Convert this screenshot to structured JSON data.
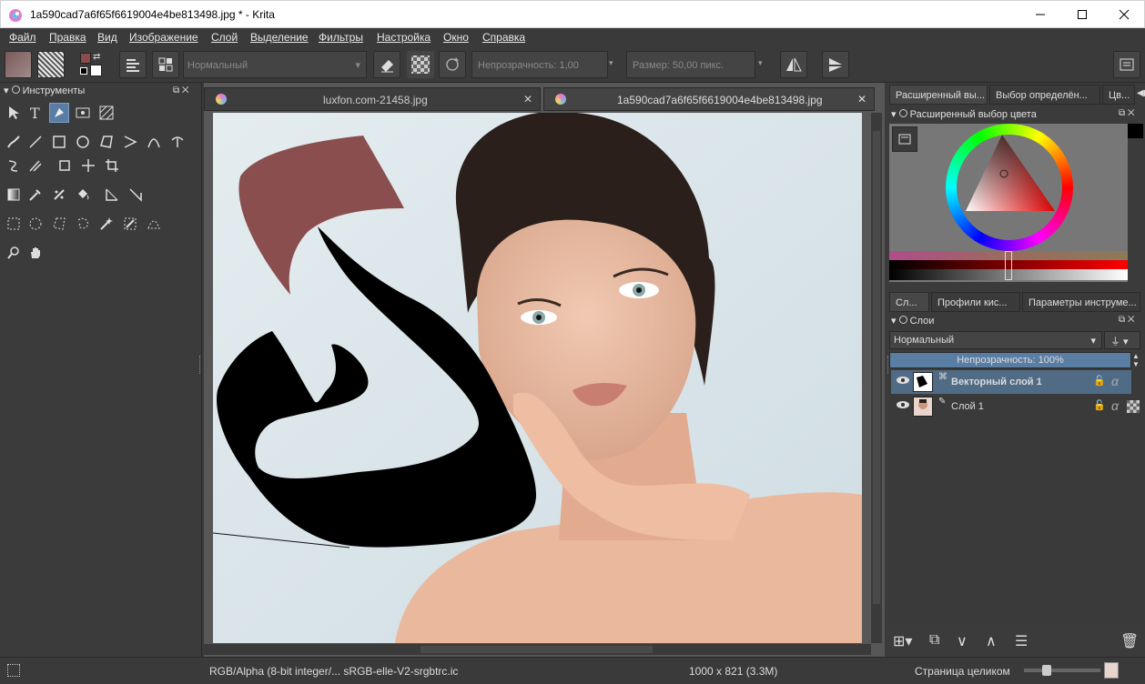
{
  "window": {
    "title": "1a590cad7a6f65f6619004e4be813498.jpg * - Krita",
    "icon": "krita-icon",
    "minimize_icon": "minimize-icon",
    "maximize_icon": "maximize-icon",
    "close_icon": "close-icon"
  },
  "menu": [
    "Файл",
    "Правка",
    "Вид",
    "Изображение",
    "Слой",
    "Выделение",
    "Фильтры",
    "Настройка",
    "Окно",
    "Справка"
  ],
  "toolbar": {
    "blend_mode": "Нормальный",
    "opacity_label": "Непрозрачность: 1,00",
    "size_label": "Размер: 50,00 пикс."
  },
  "tools_panel": {
    "title": "Инструменты"
  },
  "tabs": [
    {
      "label": "luxfon.com-21458.jpg"
    },
    {
      "label": "1a590cad7a6f65f6619004e4be813498.jpg"
    }
  ],
  "right_tabs_top": [
    "Расширенный вы...",
    "Выбор определён...",
    "Цв..."
  ],
  "color_selector": {
    "title": "Расширенный выбор цвета"
  },
  "right_tabs_mid": [
    "Сл...",
    "Профили кис...",
    "Параметры инструме..."
  ],
  "layers_panel": {
    "title": "Слои",
    "blend_mode": "Нормальный",
    "opacity": "Непрозрачность:  100%",
    "layers": [
      {
        "name": "Векторный слой 1",
        "selected": true
      },
      {
        "name": "Слой 1",
        "selected": false
      }
    ]
  },
  "status": {
    "color_space": "RGB/Alpha (8-bit integer/... sRGB-elle-V2-srgbtrc.ic",
    "dimensions": "1000 x 821 (3.3M)",
    "zoom": "Страница целиком"
  },
  "colors": {
    "foreground": "#8a4d4d",
    "background": "#ffffff",
    "shape_brown": "#8a4e4e",
    "selection": "#4f6b85"
  }
}
